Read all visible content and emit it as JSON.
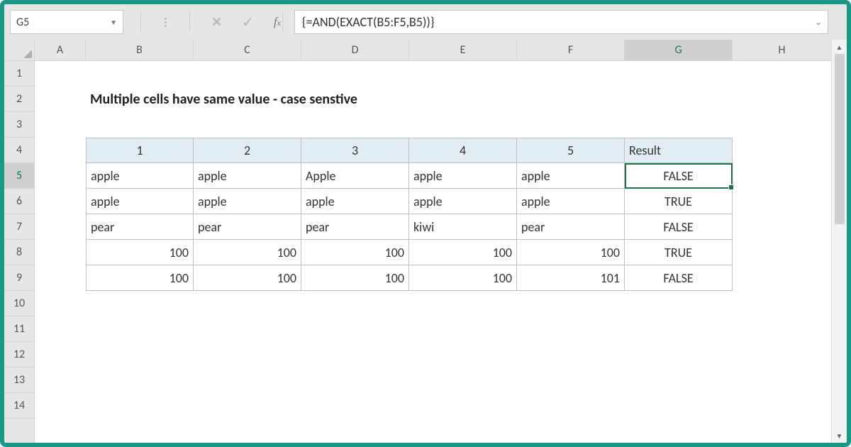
{
  "formula_bar": {
    "name_box": "G5",
    "formula": "{=AND(EXACT(B5:F5,B5))}"
  },
  "cols": [
    "A",
    "B",
    "C",
    "D",
    "E",
    "F",
    "G",
    "H"
  ],
  "rows": [
    "1",
    "2",
    "3",
    "4",
    "5",
    "6",
    "7",
    "8",
    "9",
    "10",
    "11",
    "12",
    "13",
    "14"
  ],
  "title": "Multiple cells have same value - case senstive",
  "active_cell": "G5",
  "table": {
    "headers": [
      "1",
      "2",
      "3",
      "4",
      "5",
      "Result"
    ],
    "rows": [
      [
        "apple",
        "apple",
        "Apple",
        "apple",
        "apple",
        "FALSE"
      ],
      [
        "apple",
        "apple",
        "apple",
        "apple",
        "apple",
        "TRUE"
      ],
      [
        "pear",
        "pear",
        "pear",
        "kiwi",
        "pear",
        "FALSE"
      ],
      [
        "100",
        "100",
        "100",
        "100",
        "100",
        "TRUE"
      ],
      [
        "100",
        "100",
        "100",
        "100",
        "101",
        "FALSE"
      ]
    ]
  },
  "colors": {
    "accent": "#1a9988",
    "selection": "#1f7246",
    "header_bg": "#e2ecf3"
  }
}
